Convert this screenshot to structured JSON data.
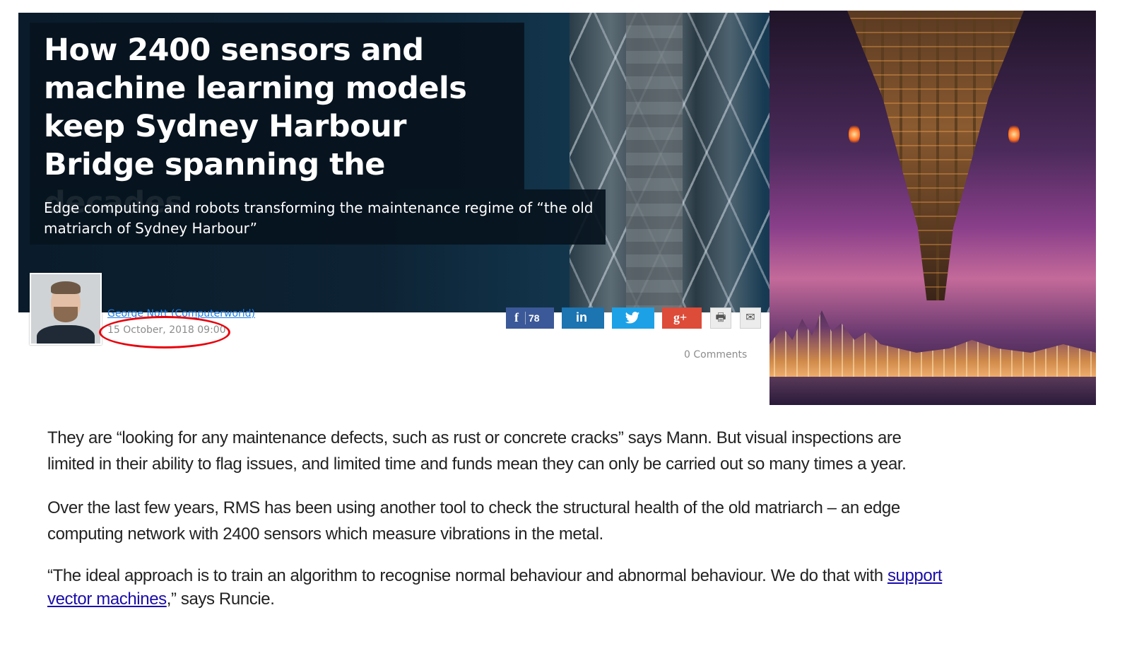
{
  "article": {
    "title": "How 2400 sensors and machine learning models keep Sydney Harbour Bridge spanning the decades",
    "subtitle": "Edge computing and robots transforming the maintenance regime of “the old matriarch of Sydney Harbour”",
    "author": "George Nott (Computerworld)",
    "date": "15 October, 2018 09:00",
    "comments": "0 Comments"
  },
  "share": {
    "facebook_glyph": "f",
    "facebook_count": "78",
    "linkedin_glyph": "in",
    "twitter_glyph": "🐦",
    "googleplus_glyph": "g+",
    "print_glyph": "🖶",
    "email_glyph": "✉"
  },
  "body": {
    "p1": "They are “looking for any maintenance defects, such as rust or concrete cracks” says Mann. But visual inspections are limited in their ability to flag issues, and limited time and funds mean they can only be carried out so many times a year.",
    "p2": "Over the last few years, RMS has been using another tool to check the structural health of the old matriarch – an edge computing network with 2400 sensors which measure vibrations in the metal.",
    "p3_before": "“The ideal approach is to train an algorithm to recognise normal behaviour and abnormal behaviour. We do that with ",
    "p3_link": "support vector machines",
    "p3_after": ",” says Runcie."
  },
  "colors": {
    "facebook": "#3b5998",
    "linkedin": "#1c74b0",
    "twitter": "#1da1e6",
    "googleplus": "#dd4b39",
    "author_link": "#1e7be0",
    "highlight_circle": "#e8000b"
  }
}
